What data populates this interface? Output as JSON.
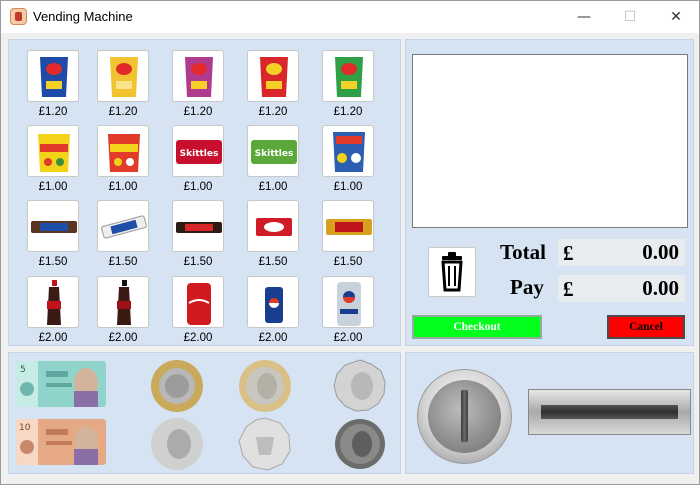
{
  "window": {
    "title": "Vending Machine",
    "controls": {
      "minimize": "—",
      "maximize": "☐",
      "close": "✕"
    }
  },
  "products": [
    {
      "icon": "walkers-crisps-blue-icon",
      "price": "£1.20",
      "color": "#1f4aa8"
    },
    {
      "icon": "walkers-crisps-yellow-icon",
      "price": "£1.20",
      "color": "#f2c230"
    },
    {
      "icon": "walkers-crisps-purple-icon",
      "price": "£1.20",
      "color": "#b03a8e"
    },
    {
      "icon": "walkers-crisps-red-icon",
      "price": "£1.20",
      "color": "#d9262b"
    },
    {
      "icon": "walkers-crisps-green-icon",
      "price": "£1.20",
      "color": "#2fa046"
    },
    {
      "icon": "haribo-bag-yellow-icon",
      "price": "£1.00",
      "color": "#f3d31a"
    },
    {
      "icon": "haribo-bag-red-icon",
      "price": "£1.00",
      "color": "#e23b2a"
    },
    {
      "icon": "skittles-red-icon",
      "price": "£1.00",
      "color": "#c8102e"
    },
    {
      "icon": "skittles-green-icon",
      "price": "£1.00",
      "color": "#5aa83a"
    },
    {
      "icon": "haribo-starmix-icon",
      "price": "£1.00",
      "color": "#2d5fb0"
    },
    {
      "icon": "snickers-bar-icon",
      "price": "£1.50",
      "color": "#5a3520"
    },
    {
      "icon": "snickers-bar-white-icon",
      "price": "£1.50",
      "color": "#e8e8e8"
    },
    {
      "icon": "mars-bar-icon",
      "price": "£1.50",
      "color": "#2b1c14"
    },
    {
      "icon": "kitkat-bar-icon",
      "price": "£1.50",
      "color": "#d01c28"
    },
    {
      "icon": "twix-bar-icon",
      "price": "£1.50",
      "color": "#d9a020"
    },
    {
      "icon": "coca-cola-bottle-icon",
      "price": "£2.00",
      "color": "#c0141c"
    },
    {
      "icon": "coke-zero-bottle-icon",
      "price": "£2.00",
      "color": "#a01018"
    },
    {
      "icon": "coca-cola-can-icon",
      "price": "£2.00",
      "color": "#d2191f"
    },
    {
      "icon": "pepsi-can-icon",
      "price": "£2.00",
      "color": "#1b3d8f"
    },
    {
      "icon": "diet-pepsi-can-icon",
      "price": "£2.00",
      "color": "#b9c6d3"
    }
  ],
  "display": {
    "text": ""
  },
  "summary": {
    "total_label": "Total",
    "pay_label": "Pay",
    "currency": "£",
    "total_value": "0.00",
    "pay_value": "0.00"
  },
  "buttons": {
    "checkout": "Checkout",
    "cancel": "Cancel"
  },
  "money": {
    "notes": [
      {
        "icon": "five-pound-note-icon",
        "value": "5",
        "color": "#7ec8c0"
      },
      {
        "icon": "ten-pound-note-icon",
        "value": "10",
        "color": "#e2a27b"
      }
    ],
    "coins": [
      {
        "icon": "two-pound-coin-icon"
      },
      {
        "icon": "one-pound-coin-icon"
      },
      {
        "icon": "fifty-pence-coin-icon"
      },
      {
        "icon": "twenty-pence-coin-icon"
      },
      {
        "icon": "ten-pence-coin-icon"
      },
      {
        "icon": "five-pence-coin-icon"
      }
    ]
  }
}
